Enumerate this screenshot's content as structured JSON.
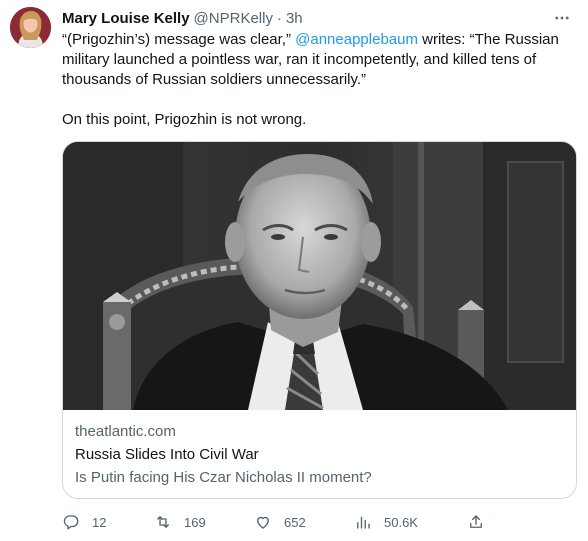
{
  "author": {
    "name": "Mary Louise Kelly",
    "handle": "@NPRKelly",
    "separator": "·",
    "time": "3h"
  },
  "tweet": {
    "line_pre": "“(Prigozhin’s) message was clear,” ",
    "mention": "@anneapplebaum",
    "line_post": " writes: “The Russian military launched a pointless war, ran it incompetently, and killed tens of thousands of Russian soldiers unnecessarily.”",
    "paragraph2": "On this point, Prigozhin is not wrong."
  },
  "card": {
    "domain": "theatlantic.com",
    "title": "Russia Slides Into Civil War",
    "description": "Is Putin facing His Czar Nicholas II moment?"
  },
  "actions": {
    "replies": "12",
    "retweets": "169",
    "likes": "652",
    "views": "50.6K"
  },
  "icons": {
    "more": "more-options-icon",
    "reply": "reply-icon",
    "retweet": "retweet-icon",
    "like": "heart-icon",
    "views": "views-icon",
    "share": "share-icon"
  },
  "colors": {
    "text": "#0f1419",
    "secondary": "#536471",
    "link": "#1d9bf0",
    "border": "#cfd9de"
  }
}
